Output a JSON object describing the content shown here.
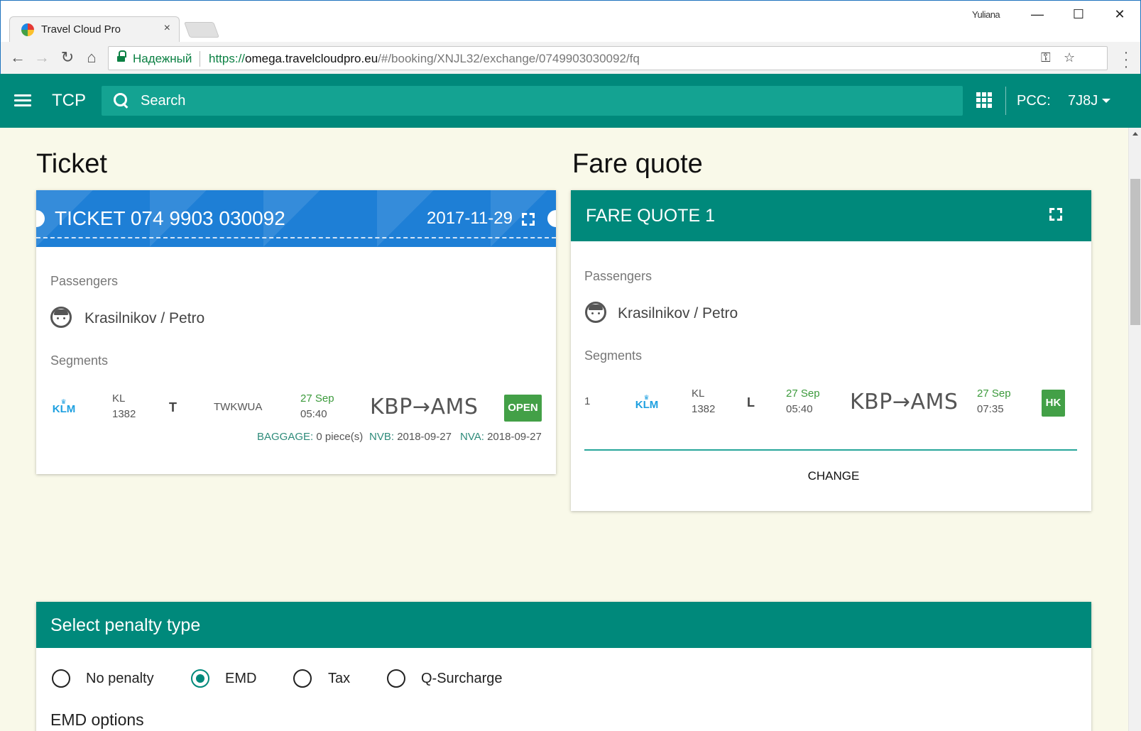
{
  "browser": {
    "tab_title": "Travel Cloud Pro",
    "tab_close": "×",
    "user": "Yuliana",
    "win_minimize": "—",
    "win_maximize": "☐",
    "win_close": "✕",
    "secure_label": "Надежный",
    "url_scheme": "https://",
    "url_host": "omega.travelcloudpro.eu",
    "url_path": "/#/booking/XNJL32/exchange/0749903030092/fq",
    "icons": [
      "back-icon",
      "forward-icon",
      "reload-icon",
      "home-icon",
      "lock-icon",
      "key-icon",
      "star-icon",
      "menu-dots-icon"
    ]
  },
  "appbar": {
    "brand": "TCP",
    "search_placeholder": "Search",
    "pcc_label": "PCC:",
    "pcc_value": "7J8J",
    "color": "#00897b"
  },
  "ticket": {
    "section_title": "Ticket",
    "title": "TICKET  074 9903 030092",
    "date": "2017-11-29",
    "passengers_label": "Passengers",
    "passenger": "Krasilnikov / Petro",
    "segments_label": "Segments",
    "segment": {
      "airline_logo": "KLM",
      "carrier": "KL",
      "flight": "1382",
      "class": "T",
      "fare_basis": "TWKWUA",
      "dep_date": "27 Sep",
      "dep_time": "05:40",
      "route": "KBP→AMS",
      "status": "OPEN",
      "baggage_label": "BAGGAGE:",
      "baggage_value": "0 piece(s)",
      "nvb_label": "NVB:",
      "nvb_value": "2018-09-27",
      "nva_label": "NVA:",
      "nva_value": "2018-09-27"
    },
    "header_color": "#1e7fd6"
  },
  "fare_quote": {
    "section_title": "Fare quote",
    "title": "FARE QUOTE 1",
    "passengers_label": "Passengers",
    "passenger": "Krasilnikov / Petro",
    "segments_label": "Segments",
    "segment": {
      "number": "1",
      "airline_logo": "KLM",
      "carrier": "KL",
      "flight": "1382",
      "class": "L",
      "dep_date": "27 Sep",
      "dep_time": "05:40",
      "route": "KBP→AMS",
      "arr_date": "27 Sep",
      "arr_time": "07:35",
      "status": "HK"
    },
    "change_label": "CHANGE"
  },
  "penalty": {
    "title": "Select penalty type",
    "options": [
      {
        "label": "No penalty",
        "checked": false
      },
      {
        "label": "EMD",
        "checked": true
      },
      {
        "label": "Tax",
        "checked": false
      },
      {
        "label": "Q-Surcharge",
        "checked": false
      }
    ],
    "emd_options_label": "EMD options"
  }
}
